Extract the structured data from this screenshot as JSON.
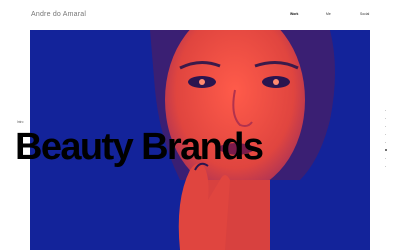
{
  "header": {
    "site_name": "Andre do Amaral",
    "nav": [
      {
        "label": "Work",
        "active": true
      },
      {
        "label": "Me",
        "active": false
      },
      {
        "label": "Social",
        "active": false
      }
    ]
  },
  "hero": {
    "kicker": "Intro",
    "headline": "Beauty Brands",
    "image_subject": "duotone portrait of a woman with hand near lips",
    "colors": {
      "background": "#13239a",
      "duotone_red": "#e0453f"
    }
  },
  "pager": {
    "count": 8,
    "active_index": 5
  }
}
